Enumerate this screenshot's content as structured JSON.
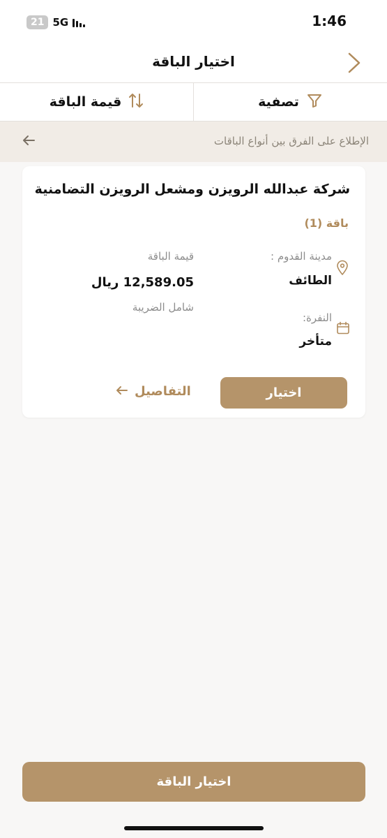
{
  "status_bar": {
    "battery": "21",
    "network": "5G",
    "time": "1:46"
  },
  "header": {
    "title": "اختيار الباقة"
  },
  "toolbar": {
    "sort_label": "قيمة الباقة",
    "filter_label": "تصفية"
  },
  "compare_banner": {
    "text": "الإطلاع على الفرق بين أنواع الباقات"
  },
  "package_card": {
    "company": "شركة عبدالله الرويزن ومشعل الرويزن التضامنية",
    "package_name": "باقة (1)",
    "arrival_city_label": "مدينة القدوم :",
    "arrival_city_value": "الطائف",
    "price_label": "قيمة الباقة",
    "price_value": "12,589.05 ريال",
    "tax_note": "شامل الضريبة",
    "nafra_label": "النفرة:",
    "nafra_value": "متأخر",
    "select_label": "اختيار",
    "details_label": "التفاصيل"
  },
  "bottom_action": {
    "label": "اختيار الباقة"
  },
  "colors": {
    "accent": "#b5946a",
    "accent_text": "#b08b5c",
    "banner_bg": "#f1ece6",
    "page_bg": "#f8f7f6"
  }
}
